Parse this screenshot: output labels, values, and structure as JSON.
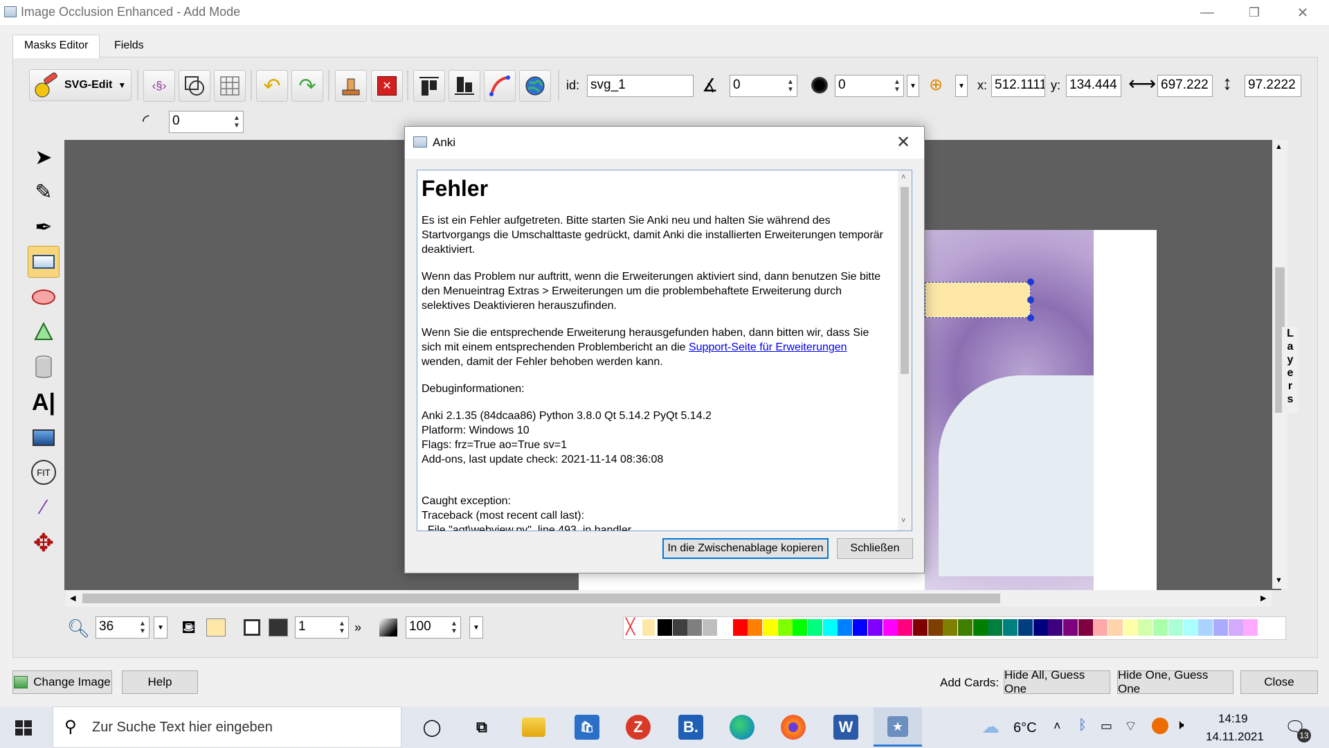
{
  "window": {
    "title": "Image Occlusion Enhanced - Add Mode",
    "minimize": "—",
    "maximize": "❐",
    "close": "✕"
  },
  "tabs": [
    {
      "label": "Masks Editor",
      "active": true
    },
    {
      "label": "Fields",
      "active": false
    }
  ],
  "toolbar": {
    "svg_edit_label": "SVG-Edit",
    "id_label": "id:",
    "id_value": "svg_1",
    "angle_value": "0",
    "blur_value": "0",
    "x_label": "x:",
    "x_value": "512.1111",
    "y_label": "y:",
    "y_value": "134.444",
    "width_value": "697.222",
    "height_value": "97.2222",
    "corner_radius_value": "0"
  },
  "layers_label": [
    "L",
    "a",
    "y",
    "e",
    "r",
    "s"
  ],
  "bottom_tools": {
    "zoom_value": "36",
    "stroke_width_value": "1",
    "opacity_value": "100",
    "fill_color": "#fde8a8",
    "stroke_color": "#333333"
  },
  "palette": [
    "#000000",
    "#3f3f3f",
    "#7f7f7f",
    "#bfbfbf",
    "#ffffff",
    "#ff0000",
    "#ff7f00",
    "#ffff00",
    "#7fff00",
    "#00ff00",
    "#00ff7f",
    "#00ffff",
    "#007fff",
    "#0000ff",
    "#7f00ff",
    "#ff00ff",
    "#ff007f",
    "#7f0000",
    "#7f3f00",
    "#7f7f00",
    "#3f7f00",
    "#007f00",
    "#007f3f",
    "#007f7f",
    "#003f7f",
    "#00007f",
    "#3f007f",
    "#7f007f",
    "#7f003f",
    "#ffaaaa",
    "#ffd4aa",
    "#ffffaa",
    "#d4ffaa",
    "#aaffaa",
    "#aaffd4",
    "#aaffff",
    "#aad4ff",
    "#aaaaff",
    "#d4aaff",
    "#ffaaff"
  ],
  "footer": {
    "change_image": "Change Image",
    "help": "Help",
    "add_cards_label": "Add Cards:",
    "hide_all": "Hide All, Guess One",
    "hide_one": "Hide One, Guess One",
    "close": "Close"
  },
  "dialog": {
    "title": "Anki",
    "heading": "Fehler",
    "p1": "Es ist ein Fehler aufgetreten. Bitte starten Sie Anki neu und halten Sie während des Startvorgangs die Umschalttaste gedrückt, damit Anki die installierten Erweiterungen temporär deaktiviert.",
    "p2": "Wenn das Problem nur auftritt, wenn die Erweiterungen aktiviert sind, dann benutzen Sie bitte den Menueintrag Extras > Erweiterungen um die problembehaftete Erweiterung durch selektives Deaktivieren herauszufinden.",
    "p3_before": "Wenn Sie die entsprechende Erweiterung herausgefunden haben, dann bitten wir, dass Sie sich mit einem entsprechenden Problembericht an die ",
    "p3_link": "Support-Seite für Erweiterungen",
    "p3_after": " wenden, damit der Fehler behoben werden kann.",
    "debug_heading": "Debuginformationen:",
    "debug_lines": [
      "Anki 2.1.35 (84dcaa86) Python 3.8.0 Qt 5.14.2 PyQt 5.14.2",
      "Platform: Windows 10",
      "Flags: frz=True ao=True sv=1",
      "Add-ons, last update check: 2021-11-14 08:36:08"
    ],
    "exception_lines": [
      "Caught exception:",
      "Traceback (most recent call last):",
      "  File \"aqt\\webview.py\", line 493, in handler"
    ],
    "copy_button": "In die Zwischenablage kopieren",
    "close_button": "Schließen"
  },
  "taskbar": {
    "search_placeholder": "Zur Suche Text hier eingeben",
    "weather": "6°C",
    "time": "14:19",
    "date": "14.11.2021",
    "notification_count": "13"
  }
}
